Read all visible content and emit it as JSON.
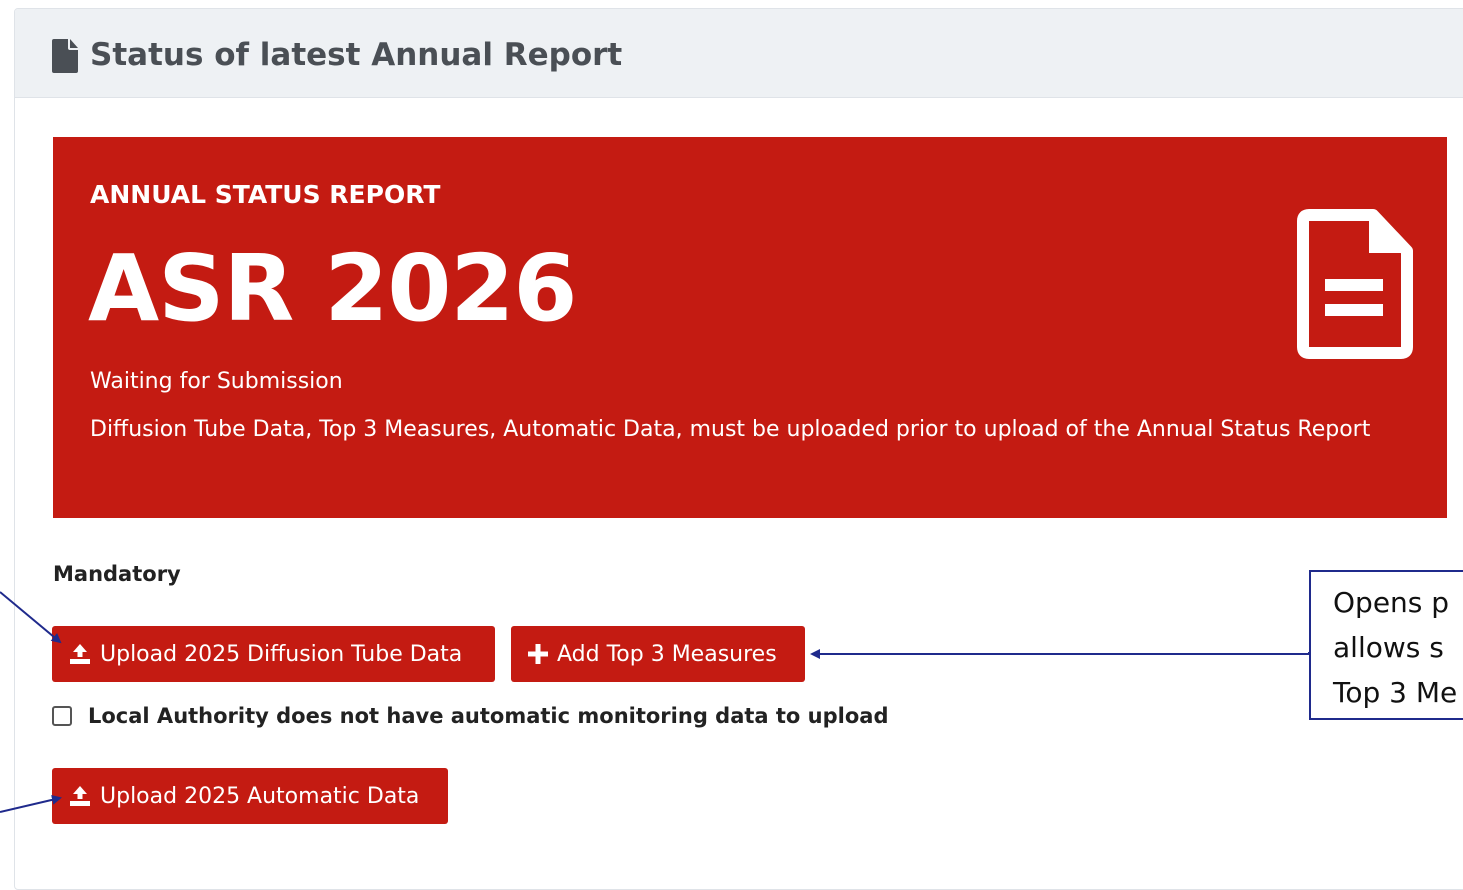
{
  "card": {
    "header_title": "Status of latest Annual Report",
    "header_icon": "file-icon"
  },
  "banner": {
    "eyebrow": "ANNUAL STATUS REPORT",
    "title": "ASR 2026",
    "status": "Waiting for Submission",
    "note": "Diffusion Tube Data, Top 3 Measures, Automatic Data, must be uploaded prior to upload of the Annual Status Report",
    "icon": "file-text-icon",
    "color": "#c41b12"
  },
  "mandatory": {
    "label": "Mandatory",
    "upload_diffusion_label": "Upload 2025 Diffusion Tube Data",
    "add_top3_label": "Add Top 3 Measures",
    "checkbox_label": "Local Authority does not have automatic monitoring data to upload",
    "checkbox_checked": false,
    "upload_automatic_label": "Upload 2025 Automatic Data"
  },
  "annotation": {
    "lines": [
      "Opens p",
      "allows s",
      "Top 3 Me"
    ]
  }
}
